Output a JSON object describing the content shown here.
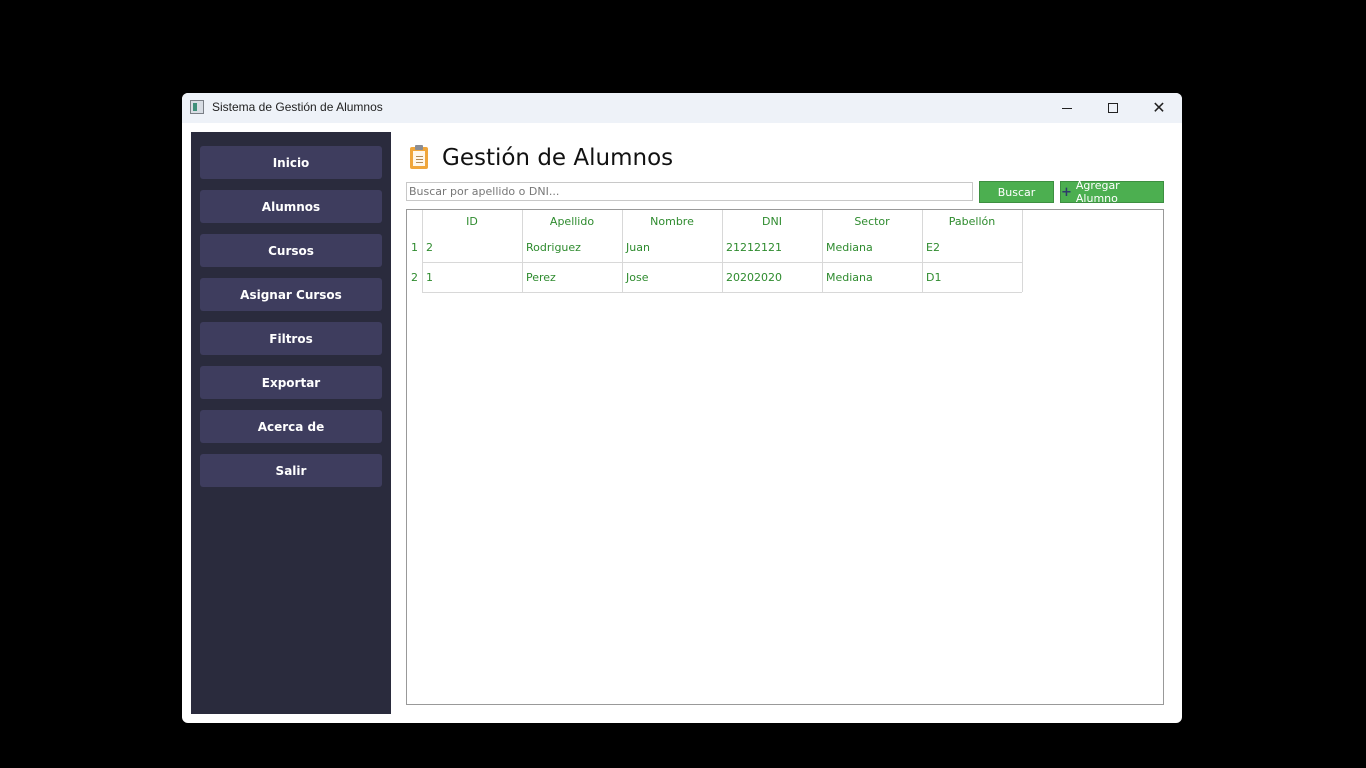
{
  "window": {
    "title": "Sistema de Gestión de Alumnos"
  },
  "sidebar": {
    "items": [
      {
        "label": "Inicio"
      },
      {
        "label": "Alumnos"
      },
      {
        "label": "Cursos"
      },
      {
        "label": "Asignar Cursos"
      },
      {
        "label": "Filtros"
      },
      {
        "label": "Exportar"
      },
      {
        "label": "Acerca de"
      },
      {
        "label": "Salir"
      }
    ]
  },
  "main": {
    "title": "Gestión de Alumnos",
    "search_placeholder": "Buscar por apellido o DNI...",
    "search_button": "Buscar",
    "add_button": "Agregar Alumno"
  },
  "table": {
    "columns": [
      "ID",
      "Apellido",
      "Nombre",
      "DNI",
      "Sector",
      "Pabellón"
    ],
    "rows": [
      {
        "row_number": "1",
        "cells": [
          "2",
          "Rodriguez",
          "Juan",
          "21212121",
          "Mediana",
          "E2"
        ]
      },
      {
        "row_number": "2",
        "cells": [
          "1",
          "Perez",
          "Jose",
          "20202020",
          "Mediana",
          "D1"
        ]
      }
    ]
  },
  "colors": {
    "sidebar_bg": "#2a2b3d",
    "nav_button_bg": "#3e3d5e",
    "action_green": "#4caf50",
    "table_text": "#2e8b2e"
  }
}
